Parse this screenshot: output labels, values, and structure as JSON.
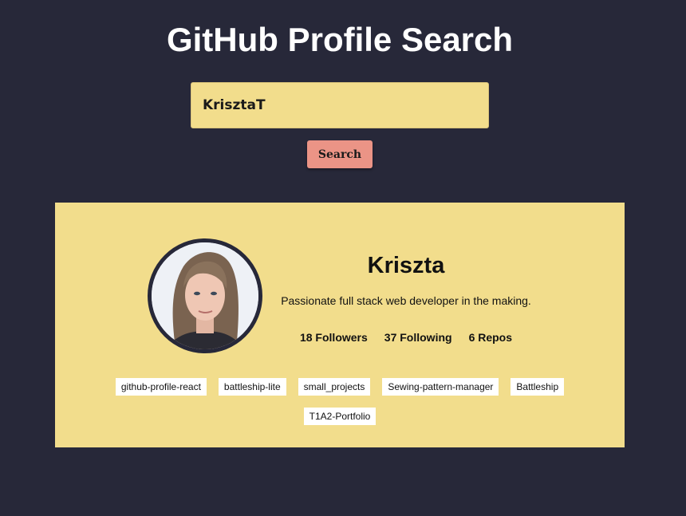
{
  "header": {
    "title": "GitHub Profile Search"
  },
  "search": {
    "value": "KrisztaT",
    "button_label": "Search"
  },
  "profile": {
    "name": "Kriszta",
    "bio": "Passionate full stack web developer in the making.",
    "followers": "18 Followers",
    "following": "37 Following",
    "repos_count": "6 Repos",
    "repos": [
      "github-profile-react",
      "battleship-lite",
      "small_projects",
      "Sewing-pattern-manager",
      "Battleship",
      "T1A2-Portfolio"
    ]
  },
  "colors": {
    "background": "#272839",
    "accent_yellow": "#f2dd8c",
    "button": "#eb9486",
    "text_light": "#ffffff",
    "text_dark": "#111111"
  }
}
